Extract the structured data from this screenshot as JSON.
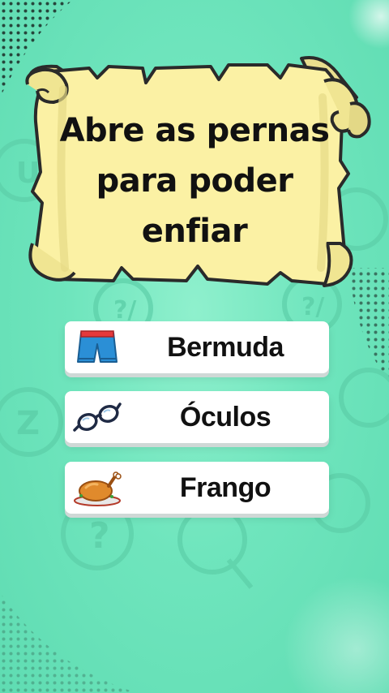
{
  "question": {
    "lines": [
      "Abre as pernas",
      "para poder",
      "enfiar"
    ]
  },
  "options": [
    {
      "label": "Bermuda",
      "icon": "shorts-icon"
    },
    {
      "label": "Óculos",
      "icon": "glasses-icon"
    },
    {
      "label": "Frango",
      "icon": "roast-chicken-icon"
    }
  ],
  "colors": {
    "background": "#6fe5bd",
    "scroll": "#fbf1a4",
    "scroll_outline": "#2a2a2a",
    "option_bg": "#ffffff",
    "text": "#111111"
  }
}
